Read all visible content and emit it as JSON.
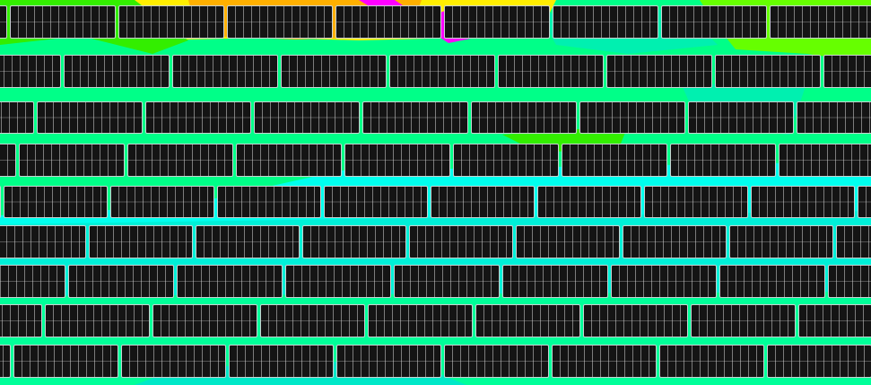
{
  "view": {
    "type": "solar-array-irradiance-heatmap",
    "background_color": "#00ff88"
  },
  "heatmap": {
    "colors": {
      "yellow": "#ffee00",
      "orange": "#ffb000",
      "magenta": "#ff00ff",
      "lime": "#33ee00",
      "light_green": "#66ff00",
      "green": "#00ff66",
      "teal": "#00f0b0",
      "cyan": "#00ffee",
      "sky": "#00e8ff"
    }
  },
  "panels": {
    "fill_color": "#141414",
    "frame_color": "#c9d2d2",
    "cell_line_color": "#d2d2d2",
    "row_count": 9
  }
}
